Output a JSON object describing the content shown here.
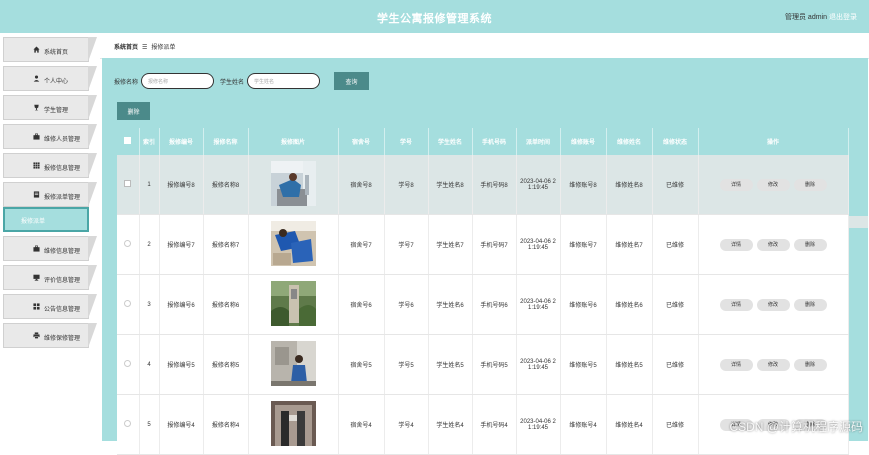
{
  "header": {
    "title": "学生公寓报修管理系统",
    "user_label": "管理员 admin",
    "logout_label": "退出登录"
  },
  "sidebar": {
    "items": [
      {
        "label": "系统首页",
        "icon": "home-icon",
        "active": false
      },
      {
        "label": "个人中心",
        "icon": "person-icon",
        "active": false
      },
      {
        "label": "学生管理",
        "icon": "trophy-icon",
        "active": false
      },
      {
        "label": "维修人员管理",
        "icon": "briefcase-icon",
        "active": false
      },
      {
        "label": "报修信息管理",
        "icon": "grid-icon",
        "active": false
      },
      {
        "label": "报修派单管理",
        "icon": "document-icon",
        "active": false
      },
      {
        "label": "报修派单",
        "icon": "",
        "active": true
      },
      {
        "label": "维修信息管理",
        "icon": "briefcase-icon",
        "active": false
      },
      {
        "label": "评价信息管理",
        "icon": "monitor-icon",
        "active": false
      },
      {
        "label": "公告信息管理",
        "icon": "apps-icon",
        "active": false
      },
      {
        "label": "维修保修管理",
        "icon": "printer-icon",
        "active": false
      }
    ]
  },
  "breadcrumb": {
    "home": "系统首页",
    "separator": "☰",
    "current": "报修派单"
  },
  "search": {
    "field1_label": "报修名称",
    "field1_placeholder": "报修名称",
    "field2_label": "学生姓名",
    "field2_placeholder": "学生姓名",
    "search_button": "查询",
    "delete_button": "删除"
  },
  "table": {
    "columns": [
      "索引",
      "报修编号",
      "报修名称",
      "报修图片",
      "宿舍号",
      "学号",
      "学生姓名",
      "手机号码",
      "派单时间",
      "维修账号",
      "维修姓名",
      "维修状态",
      "操作"
    ],
    "actions": {
      "detail": "详情",
      "edit": "修改",
      "delete": "删除"
    },
    "rows": [
      {
        "index": "1",
        "code": "报修编号8",
        "name": "报修名称8",
        "dorm": "宿舍号8",
        "sid": "学号8",
        "sname": "学生姓名8",
        "phone": "手机号码8",
        "time": "2023-04-06 21:19:45",
        "time1": "2023-04-06 2",
        "time2": "1:19:45",
        "acct": "维修账号8",
        "rname": "维修姓名8",
        "status": "已维修"
      },
      {
        "index": "2",
        "code": "报修编号7",
        "name": "报修名称7",
        "dorm": "宿舍号7",
        "sid": "学号7",
        "sname": "学生姓名7",
        "phone": "手机号码7",
        "time": "2023-04-06 21:19:45",
        "time1": "2023-04-06 2",
        "time2": "1:19:45",
        "acct": "维修账号7",
        "rname": "维修姓名7",
        "status": "已维修"
      },
      {
        "index": "3",
        "code": "报修编号6",
        "name": "报修名称6",
        "dorm": "宿舍号6",
        "sid": "学号6",
        "sname": "学生姓名6",
        "phone": "手机号码6",
        "time": "2023-04-06 21:19:45",
        "time1": "2023-04-06 2",
        "time2": "1:19:45",
        "acct": "维修账号6",
        "rname": "维修姓名6",
        "status": "已维修"
      },
      {
        "index": "4",
        "code": "报修编号5",
        "name": "报修名称5",
        "dorm": "宿舍号5",
        "sid": "学号5",
        "sname": "学生姓名5",
        "phone": "手机号码5",
        "time": "2023-04-06 21:19:45",
        "time1": "2023-04-06 2",
        "time2": "1:19:45",
        "acct": "维修账号5",
        "rname": "维修姓名5",
        "status": "已维修"
      },
      {
        "index": "5",
        "code": "报修编号4",
        "name": "报修名称4",
        "dorm": "宿舍号4",
        "sid": "学号4",
        "sname": "学生姓名4",
        "phone": "手机号码4",
        "time": "2023-04-06 21:19:45",
        "time1": "2023-04-06 2",
        "time2": "1:19:45",
        "acct": "维修账号4",
        "rname": "维修姓名4",
        "status": "已维修"
      }
    ]
  },
  "watermark": "CSDN @计算机程序源码",
  "colors": {
    "accent": "#a5dede",
    "button": "#4b8a8a",
    "highlight_row": "#dce6e6"
  }
}
